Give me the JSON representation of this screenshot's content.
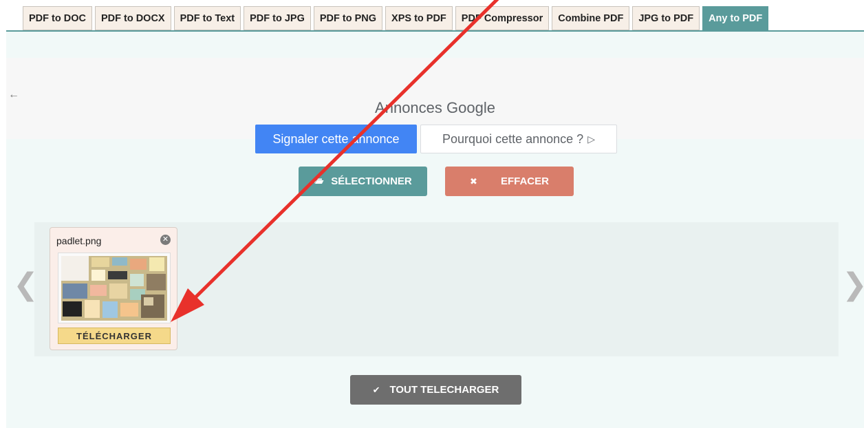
{
  "tabs": [
    {
      "label": "PDF to DOC"
    },
    {
      "label": "PDF to DOCX"
    },
    {
      "label": "PDF to Text"
    },
    {
      "label": "PDF to JPG"
    },
    {
      "label": "PDF to PNG"
    },
    {
      "label": "XPS to PDF"
    },
    {
      "label": "PDF Compressor"
    },
    {
      "label": "Combine PDF"
    },
    {
      "label": "JPG to PDF"
    },
    {
      "label": "Any to PDF",
      "active": true
    }
  ],
  "ad": {
    "label": "Annonces Google",
    "report_label": "Signaler cette annonce",
    "why_label": "Pourquoi cette annonce ?"
  },
  "actions": {
    "select_label": "SÉLECTIONNER",
    "clear_label": "EFFACER",
    "download_all_label": "TOUT TELECHARGER"
  },
  "file": {
    "name": "padlet.png",
    "download_label": "TÉLÉCHARGER"
  },
  "icons": {
    "back": "arrow-left-icon",
    "select": "folder-open-icon",
    "clear": "close-icon",
    "download_all": "checkmark-icon",
    "file_remove": "close-circle-icon",
    "carousel_prev": "chevron-left-icon",
    "carousel_next": "chevron-right-icon"
  },
  "colors": {
    "accent": "#5a9b9b",
    "clear": "#d97e6b",
    "download": "#f5d98a",
    "download_all": "#6e6e6e",
    "ad_blue": "#4285f4",
    "annotation_arrow": "#e8312b"
  }
}
